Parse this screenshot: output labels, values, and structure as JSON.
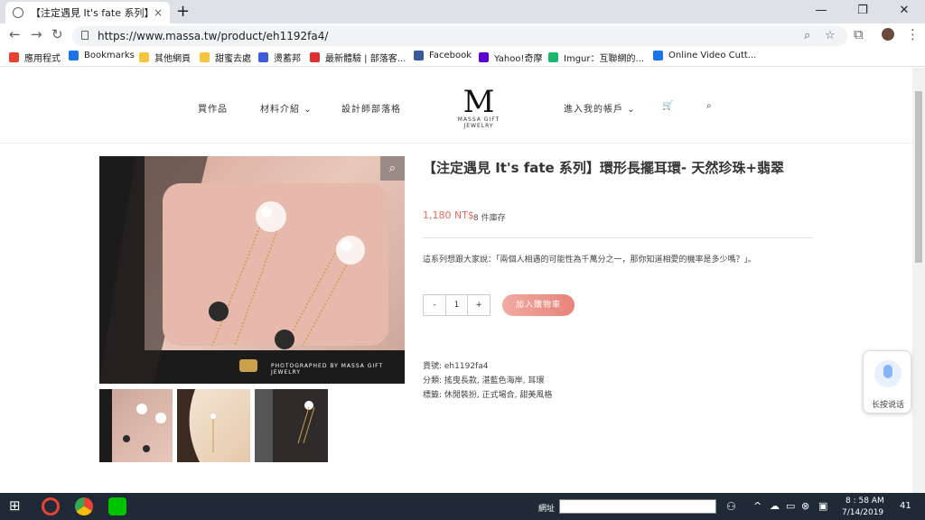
{
  "browser": {
    "tab_title": "【注定遇見 It's fate 系列】環形長",
    "tab_close": "×",
    "new_tab": "+",
    "url": "https://www.massa.tw/product/eh1192fa4/",
    "window_controls": [
      "—",
      "❐",
      "✕"
    ],
    "bookmarks": [
      {
        "label": "應用程式",
        "color": "#e94235"
      },
      {
        "label": "Bookmarks",
        "color": "#1a73e8"
      },
      {
        "label": "其他網頁",
        "color": "#f5c542"
      },
      {
        "label": "甜蜜去處",
        "color": "#f5c542"
      },
      {
        "label": "燙蓄邦",
        "color": "#3b5bdb"
      },
      {
        "label": "最新體驗 | 部落客...",
        "color": "#e03131"
      },
      {
        "label": "Facebook",
        "color": "#3b5998"
      },
      {
        "label": "Yahoo!奇摩",
        "color": "#5f01d1"
      },
      {
        "label": "Imgur：互聯網的...",
        "color": "#1bb76e"
      },
      {
        "label": "Online Video Cutt...",
        "color": "#1a73e8"
      }
    ]
  },
  "site": {
    "nav": [
      "買作品",
      "材料介紹",
      "設計師部落格",
      "進入我的帳戶"
    ],
    "logo_mark": "M",
    "logo_sub": "MASSA GIFT JEWELRY"
  },
  "product": {
    "title": "【注定遇見 It's fate 系列】環形長擺耳環- 天然珍珠+翡翠",
    "price": "1,180 NT$",
    "stock": "8 件庫存",
    "description": "這系列想跟大家說：「兩個人相遇的可能性為千萬分之一，那你知道相愛的機率是多少嗎？」。",
    "qty_minus": "-",
    "qty_value": "1",
    "qty_plus": "+",
    "add_to_cart": "加入購物車",
    "sku": "貨號: eh1192fa4",
    "categories": "分類: 搖曳長款, 湛藍色海岸, 耳環",
    "tags": "標籤: 休閒裝扮, 正式場合, 甜美風格",
    "watermark": "PHOTOGRAPHED BY MASSA GIFT JEWELRY"
  },
  "voice_widget": {
    "label": "长按说话"
  },
  "taskbar": {
    "addr_label": "網址",
    "time": "8 : 58 AM",
    "date": "7/14/2019",
    "notifications": "41"
  }
}
